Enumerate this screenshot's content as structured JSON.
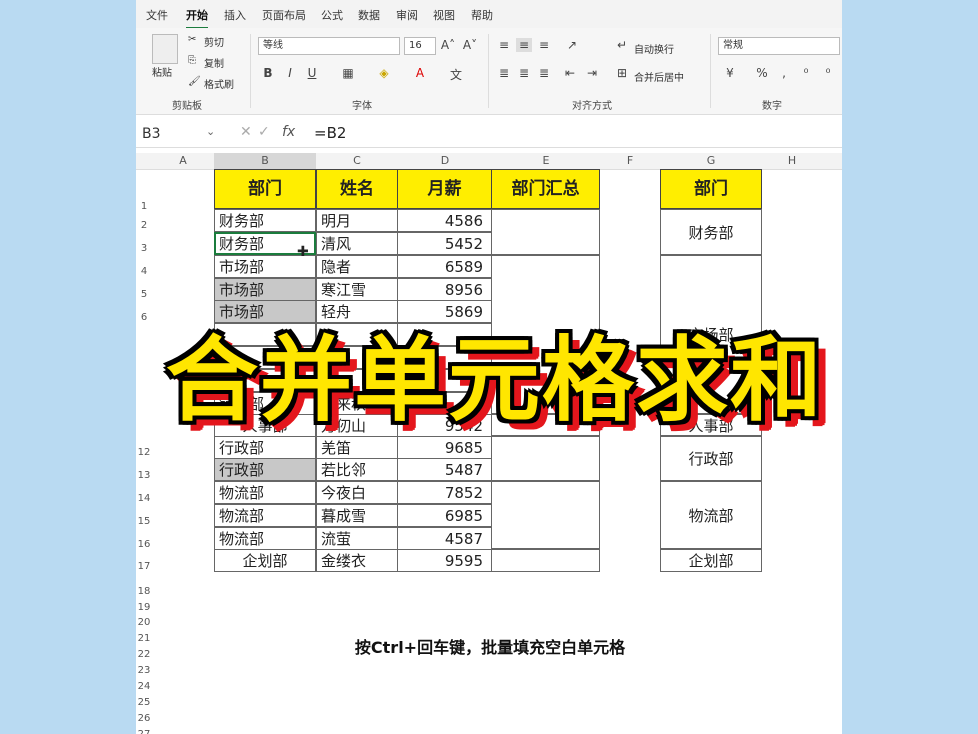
{
  "tabs": [
    "文件",
    "开始",
    "插入",
    "页面布局",
    "公式",
    "数据",
    "审阅",
    "视图",
    "帮助"
  ],
  "ribbon": {
    "clipboard": {
      "paste": "粘贴",
      "cut": "剪切",
      "copy": "复制",
      "format_painter": "格式刷",
      "label": "剪贴板"
    },
    "font": {
      "name": "等线",
      "size": "16",
      "label": "字体"
    },
    "alignment": {
      "wrap": "自动换行",
      "merge": "合并后居中",
      "label": "对齐方式"
    },
    "number": {
      "format": "常规",
      "label": "数字"
    }
  },
  "formula_bar": {
    "cell_ref": "B3",
    "formula": "=B2"
  },
  "columns": [
    "A",
    "B",
    "C",
    "D",
    "E",
    "F",
    "G",
    "H"
  ],
  "rows": [
    "1",
    "2",
    "3",
    "4",
    "5",
    "6",
    "",
    "",
    "",
    "",
    "",
    "12",
    "13",
    "14",
    "15",
    "16",
    "17",
    "18",
    "19",
    "20",
    "21",
    "22",
    "23",
    "24",
    "25",
    "26",
    "27"
  ],
  "table": {
    "headers": {
      "dept": "部门",
      "name": "姓名",
      "salary": "月薪",
      "summary": "部门汇总"
    },
    "rows": [
      {
        "dept": "财务部",
        "name": "明月",
        "salary": "4586"
      },
      {
        "dept": "财务部",
        "name": "清风",
        "salary": "5452"
      },
      {
        "dept": "市场部",
        "name": "隐者",
        "salary": "6589"
      },
      {
        "dept": "市场部",
        "name": "寒江雪",
        "salary": "8956"
      },
      {
        "dept": "市场部",
        "name": "轻舟",
        "salary": "5869"
      },
      {
        "dept": "",
        "name": "",
        "salary": ""
      },
      {
        "dept": "",
        "name": "",
        "salary": ""
      },
      {
        "dept": "",
        "name": "",
        "salary": ""
      },
      {
        "dept": "销售部",
        "name": "晚来秋",
        "salary": ""
      },
      {
        "dept": "人事部",
        "name": "万仞山",
        "salary": "9542"
      },
      {
        "dept": "行政部",
        "name": "羌笛",
        "salary": "9685"
      },
      {
        "dept": "行政部",
        "name": "若比邻",
        "salary": "5487"
      },
      {
        "dept": "物流部",
        "name": "今夜白",
        "salary": "7852"
      },
      {
        "dept": "物流部",
        "name": "暮成雪",
        "salary": "6985"
      },
      {
        "dept": "物流部",
        "name": "流萤",
        "salary": "4587"
      },
      {
        "dept": "企划部",
        "name": "金缕衣",
        "salary": "9595"
      }
    ]
  },
  "summary_table": {
    "header": "部门",
    "groups": [
      "财务部",
      "市场部",
      "人事部",
      "行政部",
      "物流部",
      "企划部"
    ]
  },
  "overlay": {
    "title": "合并单元格求和",
    "subtitle": "按Ctrl+回车键，批量填充空白单元格"
  },
  "colors": {
    "header_fill": "#ffee00",
    "title_fill": "#ffe600",
    "title_shadow": "#e4161c",
    "side_bg": "#b9daf2"
  }
}
